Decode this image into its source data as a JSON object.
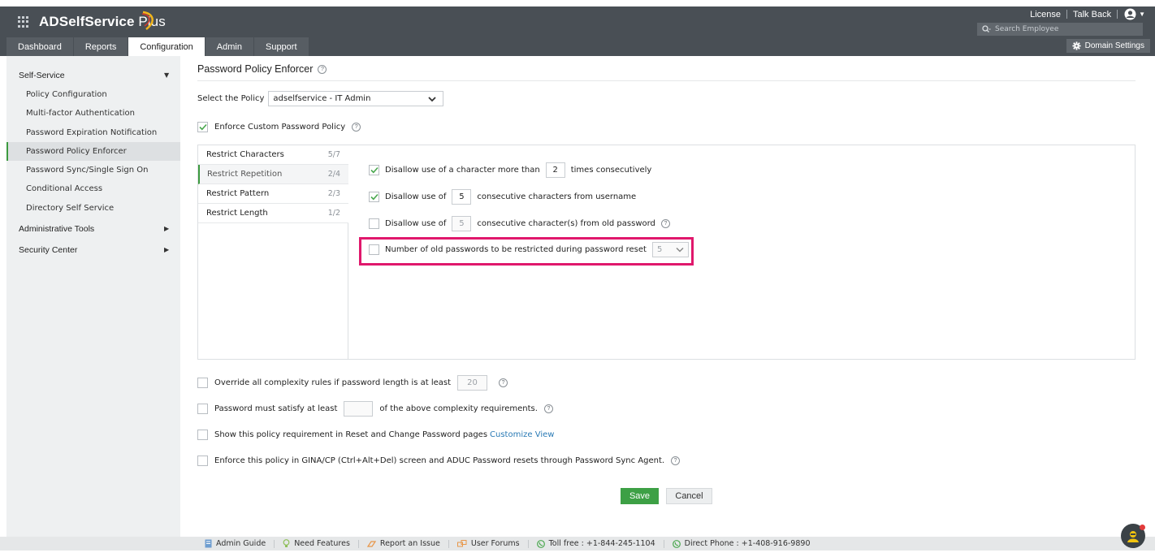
{
  "app": {
    "title": "ADSelfService Plus",
    "title_main": "ADSelfService",
    "title_plus": " Plus"
  },
  "header": {
    "links": [
      "License",
      "Talk Back"
    ],
    "search_placeholder": "Search Employee",
    "domain_settings": "Domain Settings"
  },
  "nav": {
    "tabs": [
      {
        "label": "Dashboard",
        "active": false
      },
      {
        "label": "Reports",
        "active": false
      },
      {
        "label": "Configuration",
        "active": true
      },
      {
        "label": "Admin",
        "active": false
      },
      {
        "label": "Support",
        "active": false
      }
    ]
  },
  "sidebar": {
    "sections": [
      {
        "label": "Self-Service",
        "caret": "down"
      },
      {
        "label": "Administrative Tools",
        "caret": "right"
      },
      {
        "label": "Security Center",
        "caret": "right"
      }
    ],
    "items": [
      {
        "label": "Policy Configuration",
        "active": false
      },
      {
        "label": "Multi-factor Authentication",
        "active": false
      },
      {
        "label": "Password Expiration Notification",
        "active": false
      },
      {
        "label": "Password Policy Enforcer",
        "active": true
      },
      {
        "label": "Password Sync/Single Sign On",
        "active": false
      },
      {
        "label": "Conditional Access",
        "active": false
      },
      {
        "label": "Directory Self Service",
        "active": false
      }
    ]
  },
  "main": {
    "page_title": "Password Policy Enforcer",
    "select_policy_label": "Select the Policy",
    "selected_policy": "adselfservice - IT Admin",
    "enforce_custom": {
      "label": "Enforce Custom Password Policy",
      "checked": true
    },
    "rule_tabs": [
      {
        "label": "Restrict Characters",
        "count": "5/7",
        "active": false
      },
      {
        "label": "Restrict Repetition",
        "count": "2/4",
        "active": true
      },
      {
        "label": "Restrict Pattern",
        "count": "2/3",
        "active": false
      },
      {
        "label": "Restrict Length",
        "count": "1/2",
        "active": false
      }
    ],
    "repetition_rules": [
      {
        "checked": true,
        "before": "Disallow use of a character more than",
        "value": "2",
        "after": "times consecutively"
      },
      {
        "checked": true,
        "before": "Disallow use of",
        "value": "5",
        "after": "consecutive characters from username"
      },
      {
        "checked": false,
        "before": "Disallow use of",
        "value": "5",
        "after": "consecutive character(s) from old password"
      },
      {
        "checked": false,
        "before": "Number of old passwords to be restricted during password reset",
        "value": "5",
        "after": ""
      }
    ],
    "options": [
      {
        "checked": false,
        "before": "Override all complexity rules if password length is at least",
        "value": "20",
        "after": ""
      },
      {
        "checked": false,
        "before": "Password must satisfy at least",
        "value": "",
        "after": "of the above complexity requirements."
      },
      {
        "checked": false,
        "text": "Show this policy requirement in Reset and Change Password pages",
        "link": "Customize View"
      },
      {
        "checked": false,
        "text": "Enforce this policy in GINA/CP (Ctrl+Alt+Del) screen and ADUC Password resets through Password Sync Agent."
      }
    ],
    "save_label": "Save",
    "cancel_label": "Cancel"
  },
  "footer": {
    "items": [
      {
        "icon": "book-icon",
        "label": "Admin Guide"
      },
      {
        "icon": "lightbulb-icon",
        "label": "Need Features"
      },
      {
        "icon": "report-icon",
        "label": "Report an Issue"
      },
      {
        "icon": "forum-icon",
        "label": "User Forums"
      },
      {
        "icon": "phone-icon",
        "label": "Toll free : +1-844-245-1104"
      },
      {
        "icon": "phone-icon",
        "label": "Direct Phone : +1-408-916-9890"
      }
    ]
  },
  "colors": {
    "header_bg": "#494f55",
    "accent_green": "#3da045",
    "highlight": "#e0186c",
    "link": "#2a7ab5"
  }
}
